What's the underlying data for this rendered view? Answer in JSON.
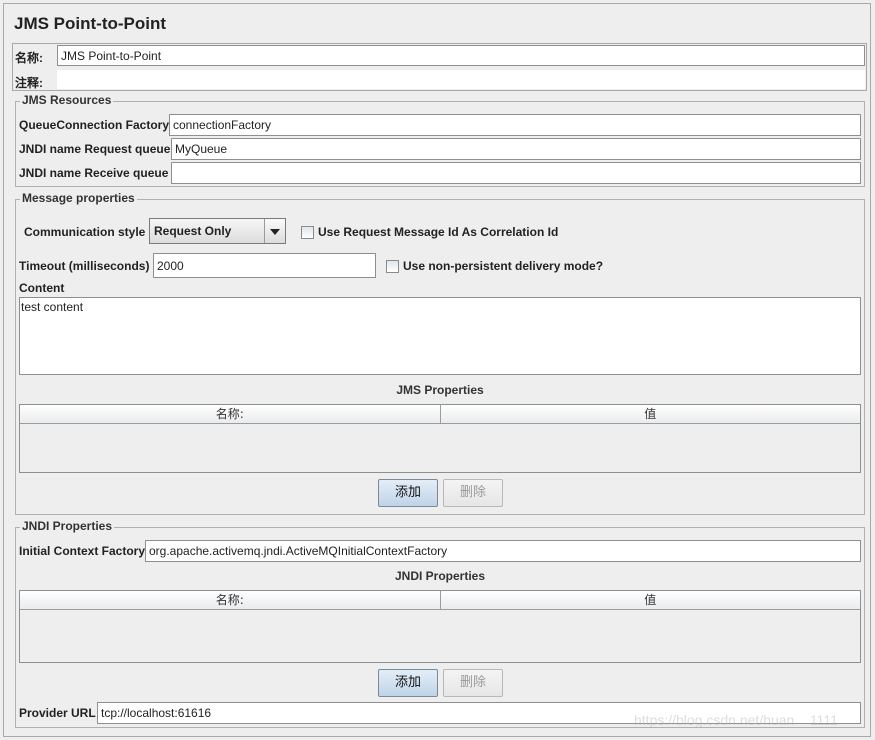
{
  "panel": {
    "title": "JMS Point-to-Point",
    "name_label": "名称:",
    "name_value": "JMS Point-to-Point",
    "comment_label": "注释:",
    "comment_value": ""
  },
  "jms_resources": {
    "legend": "JMS Resources",
    "queue_factory_label": "QueueConnection Factory",
    "queue_factory_value": "connectionFactory",
    "request_queue_label": "JNDI name Request queue",
    "request_queue_value": "MyQueue",
    "receive_queue_label": "JNDI name Receive queue",
    "receive_queue_value": ""
  },
  "message_properties": {
    "legend": "Message properties",
    "comm_style_label": "Communication style",
    "comm_style_value": "Request Only",
    "correlation_label": "Use Request Message Id As Correlation Id",
    "correlation_checked": false,
    "timeout_label": "Timeout (milliseconds)",
    "timeout_value": "2000",
    "non_persistent_label": "Use non-persistent delivery mode?",
    "non_persistent_checked": false,
    "content_label": "Content",
    "content_value": "test content",
    "jms_props_title": "JMS Properties",
    "jms_props_columns": [
      "名称:",
      "值"
    ],
    "jms_props_rows": [],
    "add_label": "添加",
    "delete_label": "删除"
  },
  "jndi_properties": {
    "legend": "JNDI Properties",
    "initial_ctx_label": "Initial Context Factory",
    "initial_ctx_value": "org.apache.activemq.jndi.ActiveMQInitialContextFactory",
    "table_title": "JNDI Properties",
    "table_columns": [
      "名称:",
      "值"
    ],
    "table_rows": [],
    "add_label": "添加",
    "delete_label": "删除",
    "provider_url_label": "Provider URL",
    "provider_url_value": "tcp://localhost:61616"
  },
  "watermark": "https://blog.csdn.net/huan__1111"
}
